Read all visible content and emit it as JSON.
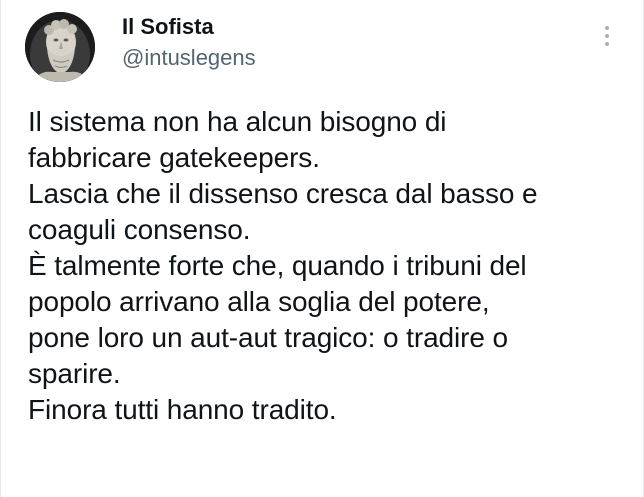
{
  "author": {
    "display_name": "Il Sofista",
    "handle": "@intuslegens",
    "avatar_icon": "greek-bust-avatar"
  },
  "menu_icon": "more-vertical-icon",
  "tweet": {
    "lines": [
      "Il sistema non ha alcun bisogno di",
      "fabbricare gatekeepers.",
      "Lascia che il dissenso cresca dal basso e",
      "coaguli consenso.",
      "È talmente forte che, quando i tribuni del",
      "popolo arrivano alla soglia del potere,",
      "pone loro un aut-aut tragico: o tradire o",
      "sparire.",
      "Finora tutti hanno tradito."
    ]
  },
  "colors": {
    "text_primary": "#0f1419",
    "text_secondary": "#536471",
    "menu_dots": "#a8b1b8"
  }
}
